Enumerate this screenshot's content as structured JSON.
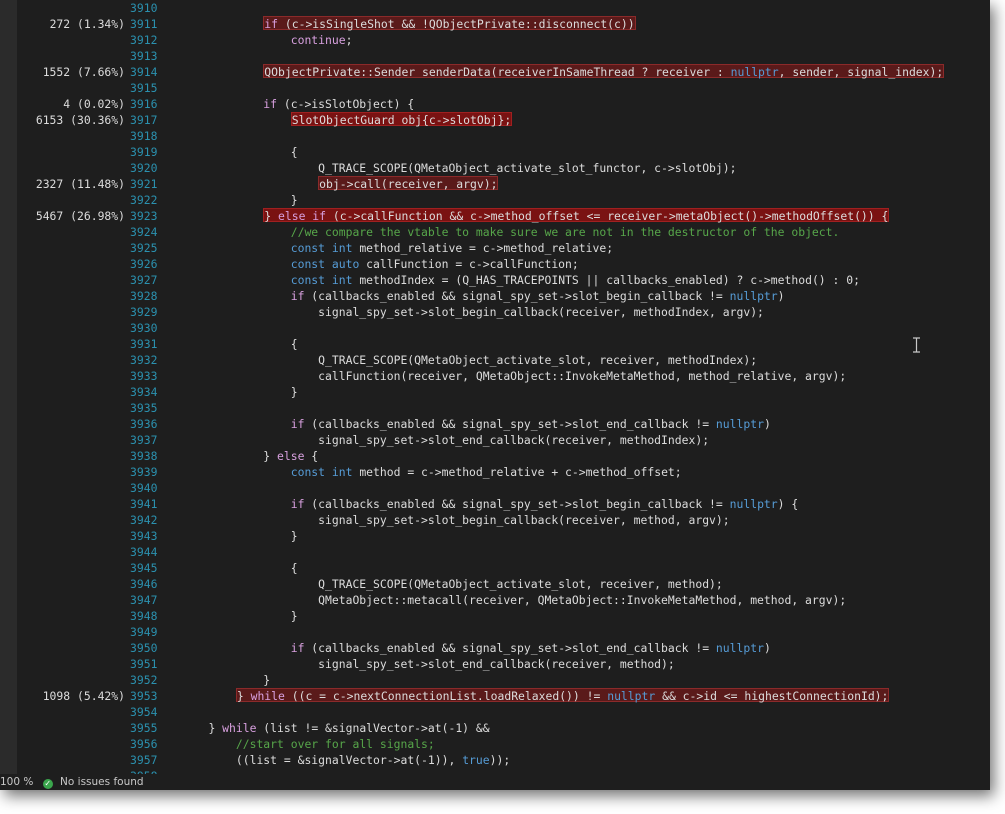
{
  "zoom": "100 %",
  "status_text": "No issues found",
  "colors": {
    "line_number": "#2b91af",
    "keyword": "#569cd6",
    "control_keyword": "#d8a0df",
    "comment": "#57a64a",
    "hot_line": "#5a1a1a"
  },
  "lines": [
    {
      "n": "3910",
      "perf": "",
      "hl": "",
      "indent": 0,
      "tokens": []
    },
    {
      "n": "3911",
      "perf": "272 (1.34%)",
      "hl": "hl",
      "indent": 12,
      "tokens": [
        [
          "kwc",
          "if"
        ],
        [
          "pl",
          " (c->isSingleShot && !QObjectPrivate::disconnect(c))"
        ]
      ]
    },
    {
      "n": "3912",
      "perf": "",
      "hl": "",
      "indent": 16,
      "tokens": [
        [
          "kwc",
          "continue"
        ],
        [
          "pl",
          ";"
        ]
      ]
    },
    {
      "n": "3913",
      "perf": "",
      "hl": "",
      "indent": 0,
      "tokens": []
    },
    {
      "n": "3914",
      "perf": "1552 (7.66%)",
      "hl": "hl",
      "indent": 12,
      "tokens": [
        [
          "pl",
          "QObjectPrivate::Sender senderData(receiverInSameThread ? receiver : "
        ],
        [
          "kw",
          "nullptr"
        ],
        [
          "pl",
          ", sender, signal_index);"
        ]
      ]
    },
    {
      "n": "3915",
      "perf": "",
      "hl": "",
      "indent": 0,
      "tokens": []
    },
    {
      "n": "3916",
      "perf": "4 (0.02%)",
      "hl": "",
      "indent": 12,
      "tokens": [
        [
          "kwc",
          "if"
        ],
        [
          "pl",
          " (c->isSlotObject) {"
        ]
      ]
    },
    {
      "n": "3917",
      "perf": "6153 (30.36%)",
      "hl": "hl strong",
      "indent": 16,
      "tokens": [
        [
          "pl",
          "SlotObjectGuard obj{c->slotObj};"
        ]
      ]
    },
    {
      "n": "3918",
      "perf": "",
      "hl": "",
      "indent": 0,
      "tokens": []
    },
    {
      "n": "3919",
      "perf": "",
      "hl": "",
      "indent": 16,
      "tokens": [
        [
          "pl",
          "{"
        ]
      ]
    },
    {
      "n": "3920",
      "perf": "",
      "hl": "",
      "indent": 20,
      "tokens": [
        [
          "pl",
          "Q_TRACE_SCOPE(QMetaObject_activate_slot_functor, c->slotObj);"
        ]
      ]
    },
    {
      "n": "3921",
      "perf": "2327 (11.48%)",
      "hl": "hl",
      "indent": 20,
      "tokens": [
        [
          "pl",
          "obj->call(receiver, argv);"
        ]
      ]
    },
    {
      "n": "3922",
      "perf": "",
      "hl": "",
      "indent": 16,
      "tokens": [
        [
          "pl",
          "}"
        ]
      ]
    },
    {
      "n": "3923",
      "perf": "5467 (26.98%)",
      "hl": "hl strong",
      "indent": 12,
      "tokens": [
        [
          "pl",
          "} "
        ],
        [
          "kwc",
          "else if"
        ],
        [
          "pl",
          " (c->callFunction && c->method_offset <= receiver->metaObject()->methodOffset()) {"
        ]
      ]
    },
    {
      "n": "3924",
      "perf": "",
      "hl": "",
      "indent": 16,
      "tokens": [
        [
          "cm",
          "//we compare the vtable to make sure we are not in the destructor of the object."
        ]
      ]
    },
    {
      "n": "3925",
      "perf": "",
      "hl": "",
      "indent": 16,
      "tokens": [
        [
          "kw",
          "const int"
        ],
        [
          "pl",
          " method_relative = c->method_relative;"
        ]
      ]
    },
    {
      "n": "3926",
      "perf": "",
      "hl": "",
      "indent": 16,
      "tokens": [
        [
          "kw",
          "const auto"
        ],
        [
          "pl",
          " callFunction = c->callFunction;"
        ]
      ]
    },
    {
      "n": "3927",
      "perf": "",
      "hl": "",
      "indent": 16,
      "tokens": [
        [
          "kw",
          "const int"
        ],
        [
          "pl",
          " methodIndex = (Q_HAS_TRACEPOINTS || callbacks_enabled) ? c->method() : 0;"
        ]
      ]
    },
    {
      "n": "3928",
      "perf": "",
      "hl": "",
      "indent": 16,
      "tokens": [
        [
          "kwc",
          "if"
        ],
        [
          "pl",
          " (callbacks_enabled && signal_spy_set->slot_begin_callback != "
        ],
        [
          "kw",
          "nullptr"
        ],
        [
          "pl",
          ")"
        ]
      ]
    },
    {
      "n": "3929",
      "perf": "",
      "hl": "",
      "indent": 20,
      "tokens": [
        [
          "pl",
          "signal_spy_set->slot_begin_callback(receiver, methodIndex, argv);"
        ]
      ]
    },
    {
      "n": "3930",
      "perf": "",
      "hl": "",
      "indent": 0,
      "tokens": []
    },
    {
      "n": "3931",
      "perf": "",
      "hl": "",
      "indent": 16,
      "tokens": [
        [
          "pl",
          "{"
        ]
      ]
    },
    {
      "n": "3932",
      "perf": "",
      "hl": "",
      "indent": 20,
      "tokens": [
        [
          "pl",
          "Q_TRACE_SCOPE(QMetaObject_activate_slot, receiver, methodIndex);"
        ]
      ]
    },
    {
      "n": "3933",
      "perf": "",
      "hl": "",
      "indent": 20,
      "tokens": [
        [
          "pl",
          "callFunction(receiver, QMetaObject::InvokeMetaMethod, method_relative, argv);"
        ]
      ]
    },
    {
      "n": "3934",
      "perf": "",
      "hl": "",
      "indent": 16,
      "tokens": [
        [
          "pl",
          "}"
        ]
      ]
    },
    {
      "n": "3935",
      "perf": "",
      "hl": "",
      "indent": 0,
      "tokens": []
    },
    {
      "n": "3936",
      "perf": "",
      "hl": "",
      "indent": 16,
      "tokens": [
        [
          "kwc",
          "if"
        ],
        [
          "pl",
          " (callbacks_enabled && signal_spy_set->slot_end_callback != "
        ],
        [
          "kw",
          "nullptr"
        ],
        [
          "pl",
          ")"
        ]
      ]
    },
    {
      "n": "3937",
      "perf": "",
      "hl": "",
      "indent": 20,
      "tokens": [
        [
          "pl",
          "signal_spy_set->slot_end_callback(receiver, methodIndex);"
        ]
      ]
    },
    {
      "n": "3938",
      "perf": "",
      "hl": "",
      "indent": 12,
      "tokens": [
        [
          "pl",
          "} "
        ],
        [
          "kwc",
          "else"
        ],
        [
          "pl",
          " {"
        ]
      ]
    },
    {
      "n": "3939",
      "perf": "",
      "hl": "",
      "indent": 16,
      "tokens": [
        [
          "kw",
          "const int"
        ],
        [
          "pl",
          " method = c->method_relative + c->method_offset;"
        ]
      ]
    },
    {
      "n": "3940",
      "perf": "",
      "hl": "",
      "indent": 0,
      "tokens": []
    },
    {
      "n": "3941",
      "perf": "",
      "hl": "",
      "indent": 16,
      "tokens": [
        [
          "kwc",
          "if"
        ],
        [
          "pl",
          " (callbacks_enabled && signal_spy_set->slot_begin_callback != "
        ],
        [
          "kw",
          "nullptr"
        ],
        [
          "pl",
          ") {"
        ]
      ]
    },
    {
      "n": "3942",
      "perf": "",
      "hl": "",
      "indent": 20,
      "tokens": [
        [
          "pl",
          "signal_spy_set->slot_begin_callback(receiver, method, argv);"
        ]
      ]
    },
    {
      "n": "3943",
      "perf": "",
      "hl": "",
      "indent": 16,
      "tokens": [
        [
          "pl",
          "}"
        ]
      ]
    },
    {
      "n": "3944",
      "perf": "",
      "hl": "",
      "indent": 0,
      "tokens": []
    },
    {
      "n": "3945",
      "perf": "",
      "hl": "",
      "indent": 16,
      "tokens": [
        [
          "pl",
          "{"
        ]
      ]
    },
    {
      "n": "3946",
      "perf": "",
      "hl": "",
      "indent": 20,
      "tokens": [
        [
          "pl",
          "Q_TRACE_SCOPE(QMetaObject_activate_slot, receiver, method);"
        ]
      ]
    },
    {
      "n": "3947",
      "perf": "",
      "hl": "",
      "indent": 20,
      "tokens": [
        [
          "pl",
          "QMetaObject::metacall(receiver, QMetaObject::InvokeMetaMethod, method, argv);"
        ]
      ]
    },
    {
      "n": "3948",
      "perf": "",
      "hl": "",
      "indent": 16,
      "tokens": [
        [
          "pl",
          "}"
        ]
      ]
    },
    {
      "n": "3949",
      "perf": "",
      "hl": "",
      "indent": 0,
      "tokens": []
    },
    {
      "n": "3950",
      "perf": "",
      "hl": "",
      "indent": 16,
      "tokens": [
        [
          "kwc",
          "if"
        ],
        [
          "pl",
          " (callbacks_enabled && signal_spy_set->slot_end_callback != "
        ],
        [
          "kw",
          "nullptr"
        ],
        [
          "pl",
          ")"
        ]
      ]
    },
    {
      "n": "3951",
      "perf": "",
      "hl": "",
      "indent": 20,
      "tokens": [
        [
          "pl",
          "signal_spy_set->slot_end_callback(receiver, method);"
        ]
      ]
    },
    {
      "n": "3952",
      "perf": "",
      "hl": "",
      "indent": 12,
      "tokens": [
        [
          "pl",
          "}"
        ]
      ]
    },
    {
      "n": "3953",
      "perf": "1098 (5.42%)",
      "hl": "hl",
      "indent": 8,
      "tokens": [
        [
          "pl",
          "} "
        ],
        [
          "kwc",
          "while"
        ],
        [
          "pl",
          " ((c = c->nextConnectionList.loadRelaxed()) != "
        ],
        [
          "kw",
          "nullptr"
        ],
        [
          "pl",
          " && c->id <= highestConnectionId);"
        ]
      ]
    },
    {
      "n": "3954",
      "perf": "",
      "hl": "",
      "indent": 0,
      "tokens": []
    },
    {
      "n": "3955",
      "perf": "",
      "hl": "",
      "indent": 4,
      "tokens": [
        [
          "pl",
          "} "
        ],
        [
          "kwc",
          "while"
        ],
        [
          "pl",
          " (list != &signalVector->at(-1) &&"
        ]
      ]
    },
    {
      "n": "3956",
      "perf": "",
      "hl": "",
      "indent": 8,
      "tokens": [
        [
          "cm",
          "//start over for all signals;"
        ]
      ]
    },
    {
      "n": "3957",
      "perf": "",
      "hl": "",
      "indent": 8,
      "tokens": [
        [
          "pl",
          "((list = &signalVector->at(-1)), "
        ],
        [
          "kw",
          "true"
        ],
        [
          "pl",
          "));"
        ]
      ]
    },
    {
      "n": "3958",
      "perf": "",
      "hl": "",
      "indent": 0,
      "tokens": []
    }
  ]
}
